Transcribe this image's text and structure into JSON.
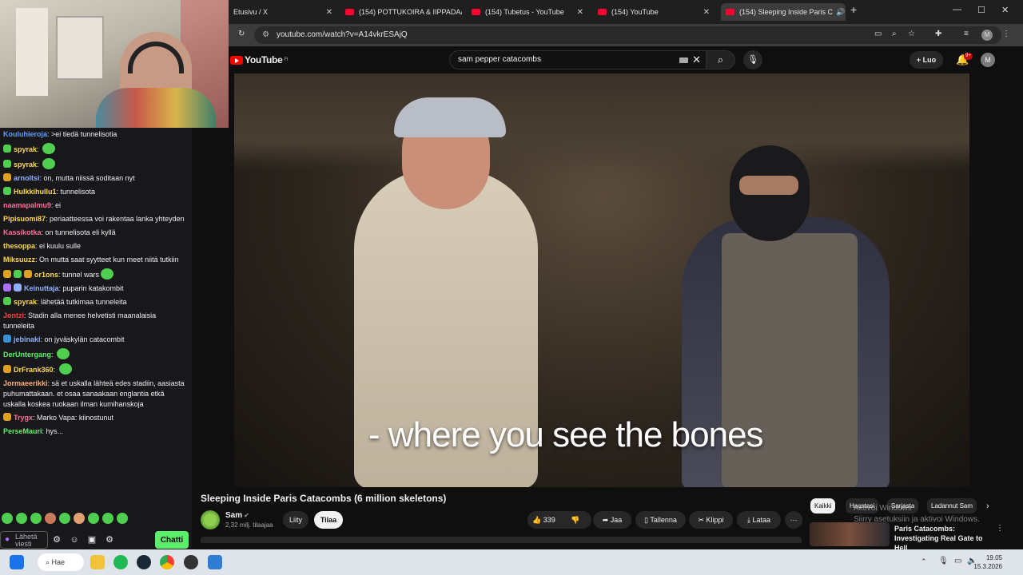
{
  "browser": {
    "tabs": [
      {
        "title": "Etusivu / X",
        "active": false
      },
      {
        "title": "(154) POTTUKOIRA & IIPPADAA",
        "active": false
      },
      {
        "title": "(154) Tubetus - YouTube",
        "active": false
      },
      {
        "title": "(154) YouTube",
        "active": false
      },
      {
        "title": "(154) Sleeping Inside Paris C",
        "active": true
      }
    ],
    "url": "youtube.com/watch?v=A14vkrESAjQ"
  },
  "youtube": {
    "logo_text": "YouTube",
    "logo_region": "FI",
    "search_query": "sam pepper catacombs",
    "create_label": "Luo",
    "notifications": "9+",
    "avatar_letter": "M",
    "caption": "- where you see the bones",
    "video_title": "Sleeping Inside Paris Catacombs (6 million skeletons)",
    "channel": {
      "name": "Sam",
      "subscribers": "2,32 milj. tilaajaa",
      "join_label": "Liity",
      "subscribe_label": "Tilaa"
    },
    "actions": {
      "likes": "339",
      "share": "Jaa",
      "save": "Tallenna",
      "clip": "Klippi",
      "download": "Lataa"
    },
    "chips": [
      "Kaikki",
      "Haustasi",
      "Sarjasta",
      "Ladannut Sam"
    ],
    "recommendation": {
      "title": "Paris Catacombs: Investigating Real Gate to Hell"
    },
    "watermark": [
      "Aktivoi Windows",
      "Siirry asetuksiin ja aktivoi Windows."
    ]
  },
  "chat": {
    "messages": [
      {
        "user": "Kouluhieroja",
        "color": "#5c9eff",
        "text": ": >ei tiedä tunnelisotia",
        "badges": []
      },
      {
        "user": "spyrak",
        "color": "#ffd84a",
        "text": ": ",
        "badges": [
          "#4fce4f"
        ],
        "emote": true
      },
      {
        "user": "spyrak",
        "color": "#ffd84a",
        "text": ": ",
        "badges": [
          "#4fce4f"
        ],
        "emote": true
      },
      {
        "user": "arnoltsi",
        "color": "#8fb0ff",
        "text": ": on, mutta niissä soditaan nyt",
        "badges": [
          "#e0a020"
        ]
      },
      {
        "user": "Hulkkihullu1",
        "color": "#ffd84a",
        "text": ": tunnelisota",
        "badges": [
          "#4fce4f"
        ]
      },
      {
        "user": "naamapalmu9",
        "color": "#ff6b9b",
        "text": ": ei",
        "badges": []
      },
      {
        "user": "Pipisuomi87",
        "color": "#ffd84a",
        "text": ": periaatteessa voi rakentaa lanka yhteyden",
        "badges": []
      },
      {
        "user": "Kassikotka",
        "color": "#ff6b9b",
        "text": ": on tunnelisota eli kyllä",
        "badges": []
      },
      {
        "user": "thesoppa",
        "color": "#ffd84a",
        "text": ": ei kuulu sulle",
        "badges": []
      },
      {
        "user": "Miksuuzz",
        "color": "#ffd84a",
        "text": ": On mutta saat syytteet kun meet niitä tutkiin",
        "badges": []
      },
      {
        "user": "or1ons",
        "color": "#ffd84a",
        "text": ": tunnel wars",
        "badges": [
          "#e0a020",
          "#4fce4f",
          "#e0a020"
        ],
        "emote": true
      },
      {
        "user": "Keinuttaja",
        "color": "#8fb0ff",
        "text": ": puparin katakombit",
        "badges": [
          "#a970ff",
          "#8fb0ff"
        ]
      },
      {
        "user": "spyrak",
        "color": "#ffd84a",
        "text": ": lähetää tutkimaa tunneleita",
        "badges": [
          "#4fce4f"
        ]
      },
      {
        "user": "Jontzi",
        "color": "#ff4040",
        "text": ": Stadin alla menee helvetisti maanalaisia tunneleita",
        "badges": []
      },
      {
        "user": "jebinaki",
        "color": "#8fb0ff",
        "text": ": on jyväskylän catacombit",
        "badges": [
          "#3a8fd9"
        ]
      },
      {
        "user": "DerUntergang",
        "color": "#5bf06a",
        "text": ": ",
        "badges": [],
        "emote": true
      },
      {
        "user": "DrFrank360",
        "color": "#ffd84a",
        "text": ": ",
        "badges": [
          "#e0a020"
        ],
        "emote": true
      },
      {
        "user": "Jormaeerikki",
        "color": "#ffb07a",
        "text": ": sä et uskalla lähteä edes stadiin, aasiasta puhumattakaan. et osaa sanaakaan englantia etkä uskalla koskea ruokaan ilman kumihanskoja",
        "badges": []
      },
      {
        "user": "Trygx",
        "color": "#ff6b9b",
        "text": ": Marko Vapa: kiinostunut",
        "badges": [
          "#e0a020"
        ]
      },
      {
        "user": "PerseMauri",
        "color": "#5bf06a",
        "text": ": hys...",
        "badges": []
      }
    ],
    "input_placeholder": "Lähetä viesti",
    "send_label": "Chatti"
  },
  "taskbar": {
    "search_label": "Hae",
    "time": "19.05",
    "date": "15.3.2026"
  }
}
